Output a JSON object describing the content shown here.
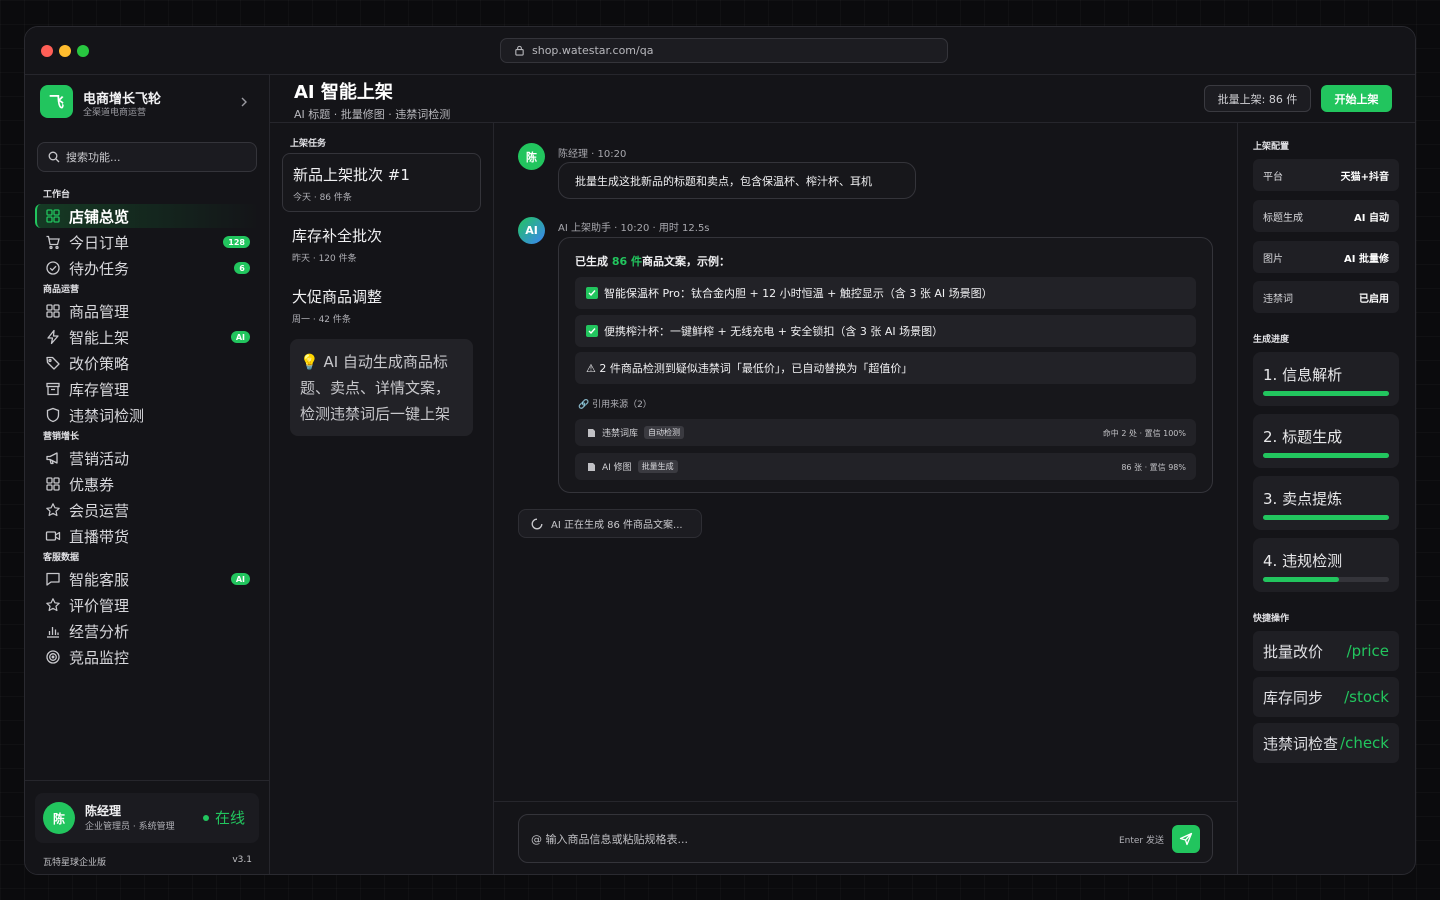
{
  "window": {
    "url": "shop.watestar.com/qa"
  },
  "brand": {
    "name": "电商增长飞轮",
    "subtitle": "全渠道电商运营",
    "logo_char": "飞"
  },
  "search": {
    "placeholder": "搜索功能..."
  },
  "sidebar": {
    "sections": [
      {
        "title": "工作台",
        "items": [
          {
            "label": "店铺总览",
            "icon": "grid-icon",
            "active": true
          },
          {
            "label": "今日订单",
            "icon": "cart-icon",
            "badge": "128"
          },
          {
            "label": "待办任务",
            "icon": "check-circle-icon",
            "badge": "6"
          }
        ]
      },
      {
        "title": "商品运营",
        "items": [
          {
            "label": "商品管理",
            "icon": "grid-icon"
          },
          {
            "label": "智能上架",
            "icon": "lightning-icon",
            "badge": "AI"
          },
          {
            "label": "改价策略",
            "icon": "tag-icon"
          },
          {
            "label": "库存管理",
            "icon": "archive-icon"
          },
          {
            "label": "违禁词检测",
            "icon": "shield-icon"
          }
        ]
      },
      {
        "title": "营销增长",
        "items": [
          {
            "label": "营销活动",
            "icon": "megaphone-icon"
          },
          {
            "label": "优惠券",
            "icon": "grid-icon"
          },
          {
            "label": "会员运营",
            "icon": "star-icon"
          },
          {
            "label": "直播带货",
            "icon": "video-icon"
          }
        ]
      },
      {
        "title": "客服数据",
        "items": [
          {
            "label": "智能客服",
            "icon": "chat-icon",
            "badge": "AI"
          },
          {
            "label": "评价管理",
            "icon": "star-icon"
          },
          {
            "label": "经营分析",
            "icon": "bar-chart-icon"
          },
          {
            "label": "竞品监控",
            "icon": "target-icon"
          }
        ]
      }
    ]
  },
  "user": {
    "name": "陈经理",
    "avatar_char": "陈",
    "role": "企业管理员 · 系统管理",
    "status": "在线"
  },
  "footer": {
    "edition": "瓦特星球企业版",
    "version": "v3.1"
  },
  "header": {
    "title": "AI 智能上架",
    "subtitle": "AI 标题 · 批量修图 · 违禁词检测",
    "batch_label": "批量上架: 86 件",
    "start_label": "开始上架"
  },
  "tasks": {
    "title": "上架任务",
    "items": [
      {
        "title": "新品上架批次 #1",
        "meta": "今天 · 86 件条"
      },
      {
        "title": "库存补全批次",
        "meta": "昨天 · 120 件条"
      },
      {
        "title": "大促商品调整",
        "meta": "周一 · 42 件条"
      }
    ],
    "tip": "AI 自动生成商品标题、卖点、详情文案，检测违禁词后一键上架"
  },
  "chat": {
    "user_msg": {
      "avatar": "陈",
      "meta": "陈经理 · 10:20",
      "text": "批量生成这批新品的标题和卖点，包含保温杯、榨汁杯、耳机"
    },
    "ai_msg": {
      "avatar": "AI",
      "meta": "AI 上架助手 · 10:20 · 用时 12.5s",
      "head_pre": "已生成 ",
      "head_count": "86 件",
      "head_post": "商品文案，示例：",
      "items": [
        "智能保温杯 Pro：钛合金内胆 + 12 小时恒温 + 触控显示（含 3 张 AI 场景图）",
        "便携榨汁杯：一键鲜榨 + 无线充电 + 安全锁扣（含 3 张 AI 场景图）"
      ],
      "warning": "⚠ 2 件商品检测到疑似违禁词「最低价」，已自动替换为「超值价」",
      "refs_title": "引用来源（2）",
      "refs": [
        {
          "name": "违禁词库",
          "tag": "自动检测",
          "stat": "命中 2 处 · 置信 100%"
        },
        {
          "name": "AI 修图",
          "tag": "批量生成",
          "stat": "86 张 · 置信 98%"
        }
      ]
    },
    "generating": "AI 正在生成 86 件商品文案..."
  },
  "composer": {
    "at": "@",
    "placeholder": "输入商品信息或粘贴规格表...",
    "hint": "Enter 发送"
  },
  "config": {
    "title": "上架配置",
    "rows": [
      {
        "key": "平台",
        "value": "天猫+抖音"
      },
      {
        "key": "标题生成",
        "value": "AI 自动"
      },
      {
        "key": "图片",
        "value": "AI 批量修"
      },
      {
        "key": "违禁词",
        "value": "已启用"
      }
    ]
  },
  "progress": {
    "title": "生成进度",
    "steps": [
      {
        "label": "1. 信息解析",
        "pct": 100
      },
      {
        "label": "2. 标题生成",
        "pct": 100
      },
      {
        "label": "3. 卖点提炼",
        "pct": 100
      },
      {
        "label": "4. 违规检测",
        "pct": 60
      }
    ]
  },
  "quick": {
    "title": "快捷操作",
    "actions": [
      {
        "label": "批量改价",
        "cmd": "/price"
      },
      {
        "label": "库存同步",
        "cmd": "/stock"
      },
      {
        "label": "违禁词检查",
        "cmd": "/check"
      }
    ]
  },
  "colors": {
    "accent": "#22c55e",
    "bg": "#141418",
    "panel": "#1f1f24"
  }
}
